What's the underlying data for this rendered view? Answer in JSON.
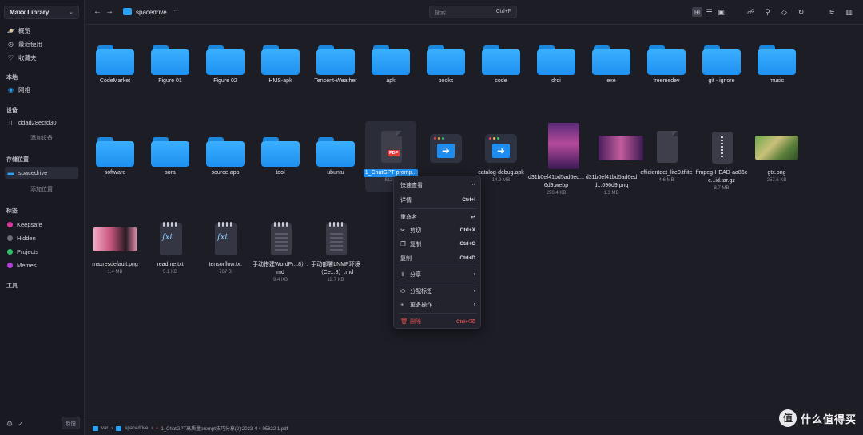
{
  "sidebar": {
    "library": "Maxx Library",
    "nav": [
      {
        "label": "概览",
        "icon": "planet-icon"
      },
      {
        "label": "最近使用",
        "icon": "clock-icon"
      },
      {
        "label": "收藏夹",
        "icon": "heart-icon"
      }
    ],
    "local_section": "本地",
    "local_items": [
      {
        "label": "网络",
        "icon": "network-icon"
      }
    ],
    "devices_section": "设备",
    "device_name": "ddad28ecfd30",
    "add_device": "添加设备",
    "locations_section": "存储位置",
    "location_name": "spacedrive",
    "add_location": "添加位置",
    "tags_section": "标签",
    "tags": [
      {
        "label": "Keepsafe",
        "color": "#d6389b"
      },
      {
        "label": "Hidden",
        "color": "#6b6c76"
      },
      {
        "label": "Projects",
        "color": "#2fbf6a"
      },
      {
        "label": "Memes",
        "color": "#b340d6"
      }
    ],
    "tools_section": "工具",
    "feedback": "反馈"
  },
  "topbar": {
    "path": "spacedrive",
    "search_placeholder": "搜索",
    "search_shortcut": "Ctrl+F"
  },
  "files": [
    {
      "name": "CodeMarket",
      "kind": "folder"
    },
    {
      "name": "Figure 01",
      "kind": "folder"
    },
    {
      "name": "Figure 02",
      "kind": "folder"
    },
    {
      "name": "HMS-apk",
      "kind": "folder"
    },
    {
      "name": "Tencent-Weather",
      "kind": "folder"
    },
    {
      "name": "apk",
      "kind": "folder"
    },
    {
      "name": "books",
      "kind": "folder"
    },
    {
      "name": "code",
      "kind": "folder"
    },
    {
      "name": "droi",
      "kind": "folder"
    },
    {
      "name": "exe",
      "kind": "folder"
    },
    {
      "name": "freemedev",
      "kind": "folder"
    },
    {
      "name": "git - ignore",
      "kind": "folder"
    },
    {
      "name": "music",
      "kind": "folder"
    },
    {
      "name": "software",
      "kind": "folder"
    },
    {
      "name": "sora",
      "kind": "folder"
    },
    {
      "name": "source-app",
      "kind": "folder"
    },
    {
      "name": "tool",
      "kind": "folder"
    },
    {
      "name": "ubuntu",
      "kind": "folder"
    },
    {
      "name": "1_ChatGPT promp...",
      "kind": "pdf",
      "size": "812.7",
      "badge": "PDF"
    },
    {
      "name": "",
      "kind": "apk",
      "size": ""
    },
    {
      "name": "catalog-debug.apk",
      "kind": "apk",
      "size": "14.9 MB"
    },
    {
      "name": "d31b0ef41bd5ad6ed...6d9.webp",
      "kind": "photo-purple",
      "size": "290.4 KB"
    },
    {
      "name": "d31b0ef41bd5ad6edd...696d9.png",
      "kind": "photo-purple-wide",
      "size": "1.3 MB"
    },
    {
      "name": "efficientdet_lite0.tflite",
      "kind": "doc",
      "size": "4.6 MB"
    },
    {
      "name": "ffmpeg-HEAD-aa86cc...id.tar.gz",
      "kind": "zip",
      "size": "8.7 MB"
    },
    {
      "name": "gtx.png",
      "kind": "photo-green",
      "size": "257.6 KB"
    },
    {
      "name": "maxresdefault.png",
      "kind": "photo-pink",
      "size": "1.4 MB"
    },
    {
      "name": "readme.txt",
      "kind": "txt",
      "size": "5.1 KB"
    },
    {
      "name": "tensorflow.txt",
      "kind": "txt",
      "size": "767 B"
    },
    {
      "name": "手动搭建WordPr...8）.md",
      "kind": "md",
      "size": "9.4 KB"
    },
    {
      "name": "手动部署LNMP环境（Ce...8）.md",
      "kind": "md",
      "size": "12.7 KB"
    }
  ],
  "context_menu": {
    "quick_view": "快速查看",
    "details": "详情",
    "details_kb": "Ctrl+I",
    "rename": "重命名",
    "cut": "剪切",
    "cut_kb": "Ctrl+X",
    "copy": "复制",
    "copy_kb": "Ctrl+C",
    "duplicate": "复制",
    "duplicate_kb": "Ctrl+D",
    "share": "分享",
    "assign_tag": "分配标签",
    "more_actions": "更多操作...",
    "delete": "删除",
    "delete_kb": "Ctrl+⌫"
  },
  "statusbar": {
    "crumb1": "var",
    "crumb2": "spacedrive",
    "crumb3": "1_ChatGPT高质量prompt技巧分享(2) 2023-4-4 95822 1.pdf"
  },
  "watermark": {
    "circle": "值",
    "text": "什么值得买"
  }
}
